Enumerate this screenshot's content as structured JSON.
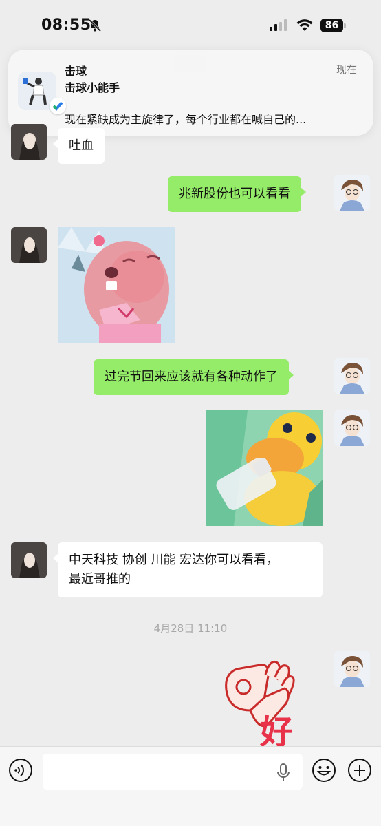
{
  "status_bar": {
    "time": "08:55",
    "battery": "86"
  },
  "notification": {
    "app": "击球",
    "sender": "击球小能手",
    "time": "现在",
    "body": "现在紧缺成为主旋律了，每个行业都在喊自己的..."
  },
  "messages": [
    {
      "side": "left",
      "type": "text",
      "text": "吐血"
    },
    {
      "side": "right",
      "type": "text",
      "text": "兆新股份也可以看看"
    },
    {
      "side": "left",
      "type": "sticker",
      "icon": "crying-beaver-sticker"
    },
    {
      "side": "right",
      "type": "text",
      "text": "过完节回来应该就有各种动作了"
    },
    {
      "side": "right",
      "type": "sticker",
      "icon": "duck-with-bottle-sticker"
    },
    {
      "side": "left",
      "type": "text",
      "lines": [
        "中天科技 协创 川能 宏达你可以看看，",
        "最近哥推的"
      ]
    },
    {
      "side": "right",
      "type": "sticker",
      "icon": "ok-hand-hao-sticker",
      "text": "好"
    }
  ],
  "timestamp": "4月28日 11:10",
  "input_bar": {
    "placeholder": ""
  },
  "colors": {
    "self_bubble": "#95ec69",
    "other_bubble": "#ffffff",
    "background": "#ededed"
  }
}
